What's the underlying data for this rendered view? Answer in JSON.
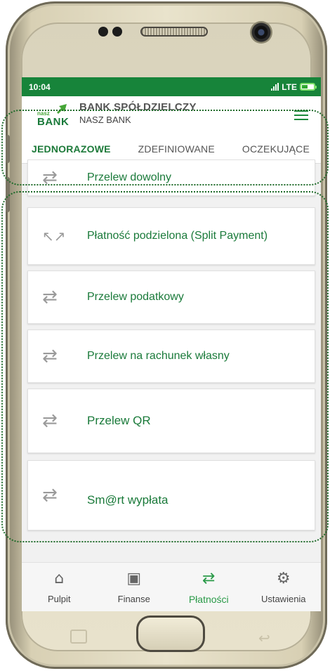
{
  "status_bar": {
    "time": "10:04",
    "network": "LTE",
    "colors": {
      "bar": "#17843a"
    }
  },
  "header": {
    "logo_small": "nasz",
    "logo_large": "BANK",
    "bank_name": "BANK SPÓŁDZIELCZY",
    "bank_sub": "NASZ BANK",
    "menu_icon": "hamburger-icon"
  },
  "tabs": [
    {
      "label": "JEDNORAZOWE",
      "active": true
    },
    {
      "label": "ZDEFINIOWANE",
      "active": false
    },
    {
      "label": "OCZEKUJĄCE",
      "active": false
    }
  ],
  "payment_items": [
    {
      "label": "Przelew dowolny",
      "icon": "transfer-arrows-icon"
    },
    {
      "label": "Płatność podzielona (Split Payment)",
      "icon": "split-arrows-icon"
    },
    {
      "label": "Przelew podatkowy",
      "icon": "transfer-arrows-icon"
    },
    {
      "label": "Przelew na rachunek własny",
      "icon": "transfer-arrows-icon"
    },
    {
      "label": "Przelew QR",
      "icon": "transfer-arrows-icon"
    },
    {
      "label": "Sm@rt wypłata",
      "icon": "transfer-arrows-icon"
    }
  ],
  "bottom_nav": [
    {
      "label": "Pulpit",
      "icon": "home-icon",
      "active": false
    },
    {
      "label": "Finanse",
      "icon": "briefcase-icon",
      "active": false
    },
    {
      "label": "Płatności",
      "icon": "transfer-arrows-icon",
      "active": true
    },
    {
      "label": "Ustawienia",
      "icon": "gear-icon",
      "active": false
    }
  ],
  "colors": {
    "accent": "#1a7a3a",
    "active_nav": "#2a9a48"
  }
}
